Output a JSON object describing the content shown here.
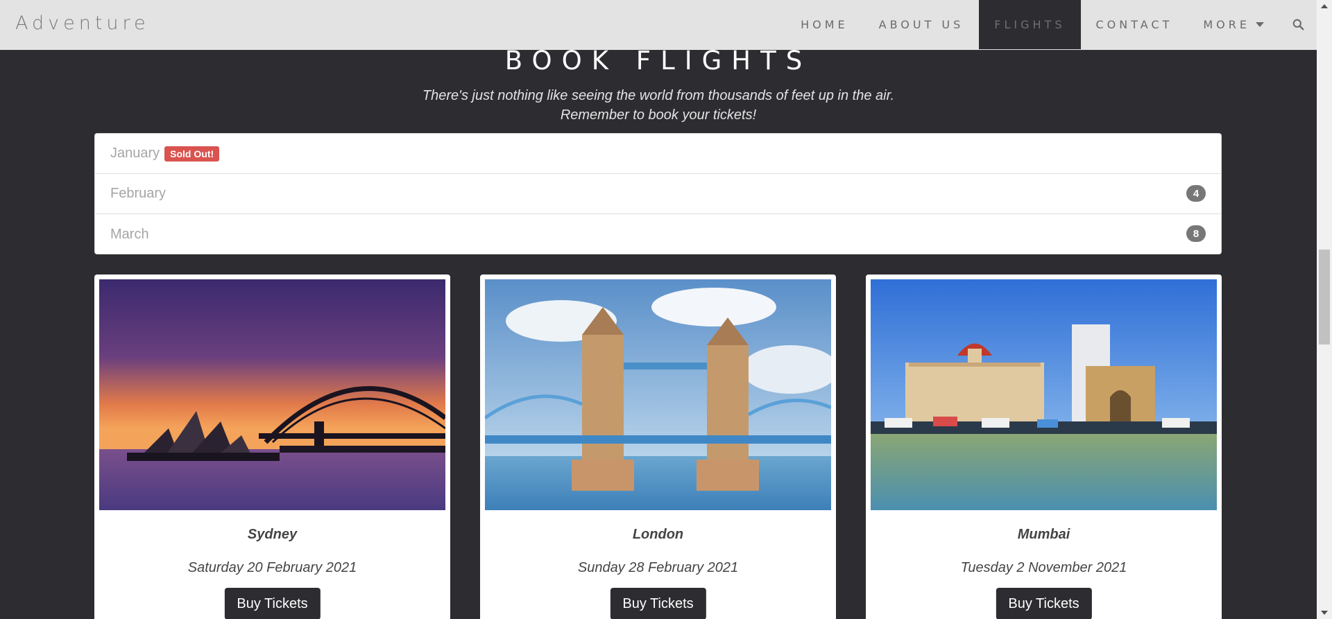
{
  "brand": "Adventure",
  "nav": {
    "home": "HOME",
    "about": "ABOUT US",
    "flights": "FLIGHTS",
    "contact": "CONTACT",
    "more": "MORE"
  },
  "hero": {
    "title": "BOOK FLIGHTS",
    "subtitle_line1": "There's just nothing like seeing the world from thousands of feet up in the air.",
    "subtitle_line2": "Remember to book your tickets!"
  },
  "months": [
    {
      "label": "January",
      "badge": "Sold Out!"
    },
    {
      "label": "February",
      "count": "4"
    },
    {
      "label": "March",
      "count": "8"
    }
  ],
  "cards": [
    {
      "city": "Sydney",
      "date": "Saturday 20 February 2021",
      "button": "Buy Tickets"
    },
    {
      "city": "London",
      "date": "Sunday 28 February 2021",
      "button": "Buy Tickets"
    },
    {
      "city": "Mumbai",
      "date": "Tuesday 2 November 2021",
      "button": "Buy Tickets"
    }
  ],
  "colors": {
    "background": "#2d2c31",
    "navbar": "#e3e3e3",
    "sold_out": "#d9534f",
    "count_badge": "#777777"
  },
  "icons": {
    "search": "search-icon",
    "caret": "chevron-down-icon"
  }
}
